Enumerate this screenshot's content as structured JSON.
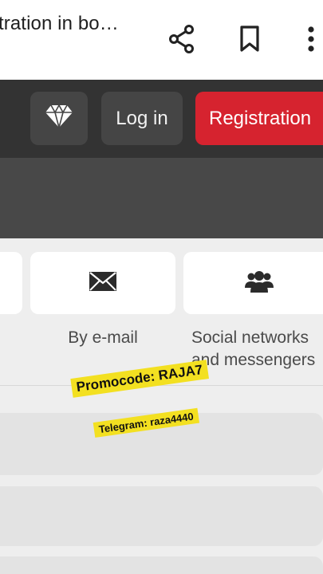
{
  "browser": {
    "title": "tration in bo…",
    "icons": [
      "share-icon",
      "bookmark-icon",
      "more-vert-icon"
    ]
  },
  "header": {
    "login_label": "Log in",
    "registration_label": "Registration",
    "icon": "diamond-icon"
  },
  "methods": {
    "email_label": "By e-mail",
    "social_label_line1": "Social networks",
    "social_label_line2": "and messengers",
    "email_icon": "envelope-icon",
    "social_icon": "users-icon"
  },
  "overlay": {
    "promocode": "Promocode: RAJA7",
    "telegram": "Telegram: raza4440"
  },
  "colors": {
    "accent_red": "#d6232f",
    "header_dark": "#333333",
    "sticker_yellow": "#f3e021"
  }
}
